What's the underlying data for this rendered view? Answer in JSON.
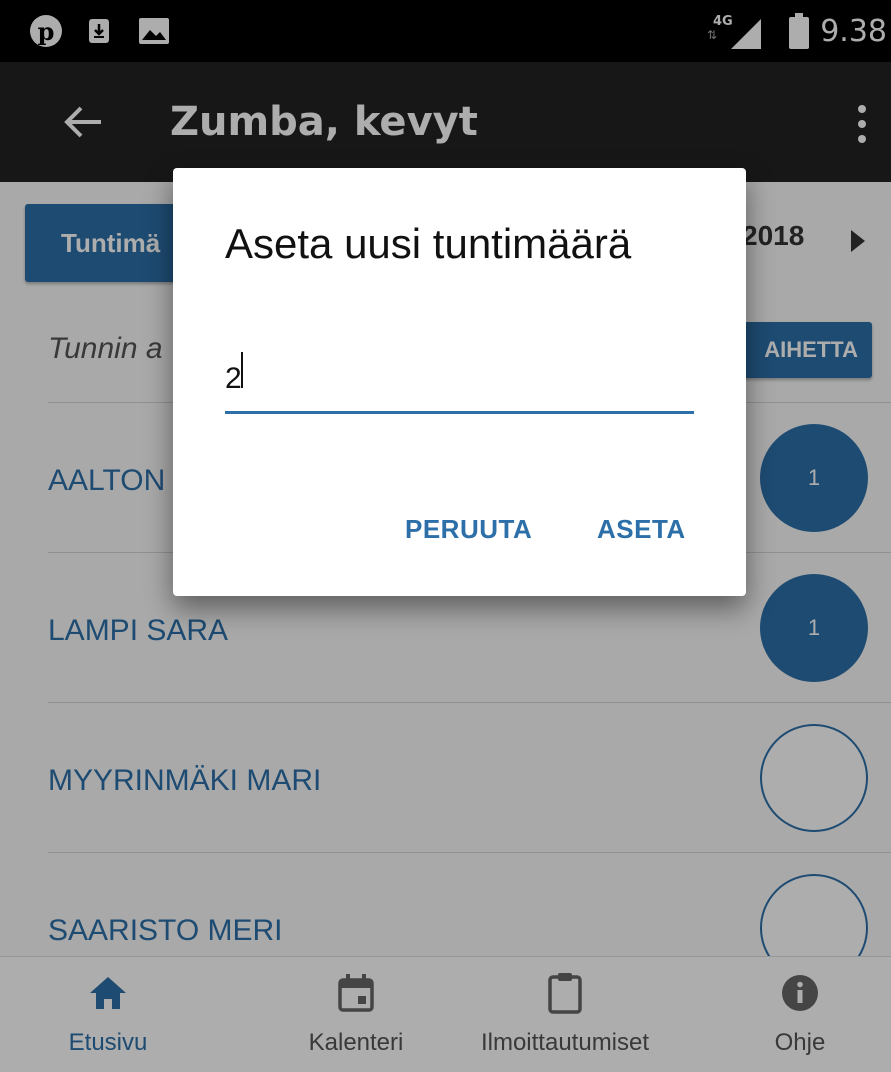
{
  "status_bar": {
    "network": "4G",
    "time": "9.38"
  },
  "toolbar": {
    "title": "Zumba, kevyt"
  },
  "content": {
    "hours_button_label": "Tuntimä",
    "date_label": "2018",
    "topic_hint": "Tunnin a",
    "topic_button_label": "AIHETTA",
    "participants": [
      {
        "name": "AALTON",
        "count": "1",
        "filled": true
      },
      {
        "name": "LAMPI SARA",
        "count": "1",
        "filled": true
      },
      {
        "name": "MYYRINMÄKI MARI",
        "count": "",
        "filled": false
      },
      {
        "name": "SAARISTO MERI",
        "count": "",
        "filled": false
      }
    ]
  },
  "bottom_nav": {
    "items": [
      {
        "label": "Etusivu",
        "icon": "home-icon",
        "active": true
      },
      {
        "label": "Kalenteri",
        "icon": "calendar-icon",
        "active": false
      },
      {
        "label": "Ilmoittautumiset",
        "icon": "clipboard-icon",
        "active": false
      },
      {
        "label": "Ohje",
        "icon": "info-icon",
        "active": false
      }
    ]
  },
  "dialog": {
    "title": "Aseta uusi tuntimäärä",
    "input_value": "2",
    "cancel_label": "PERUUTA",
    "ok_label": "ASETA"
  },
  "colors": {
    "primary": "#2d6fa8",
    "toolbar": "#222222",
    "statusbar": "#000000"
  }
}
